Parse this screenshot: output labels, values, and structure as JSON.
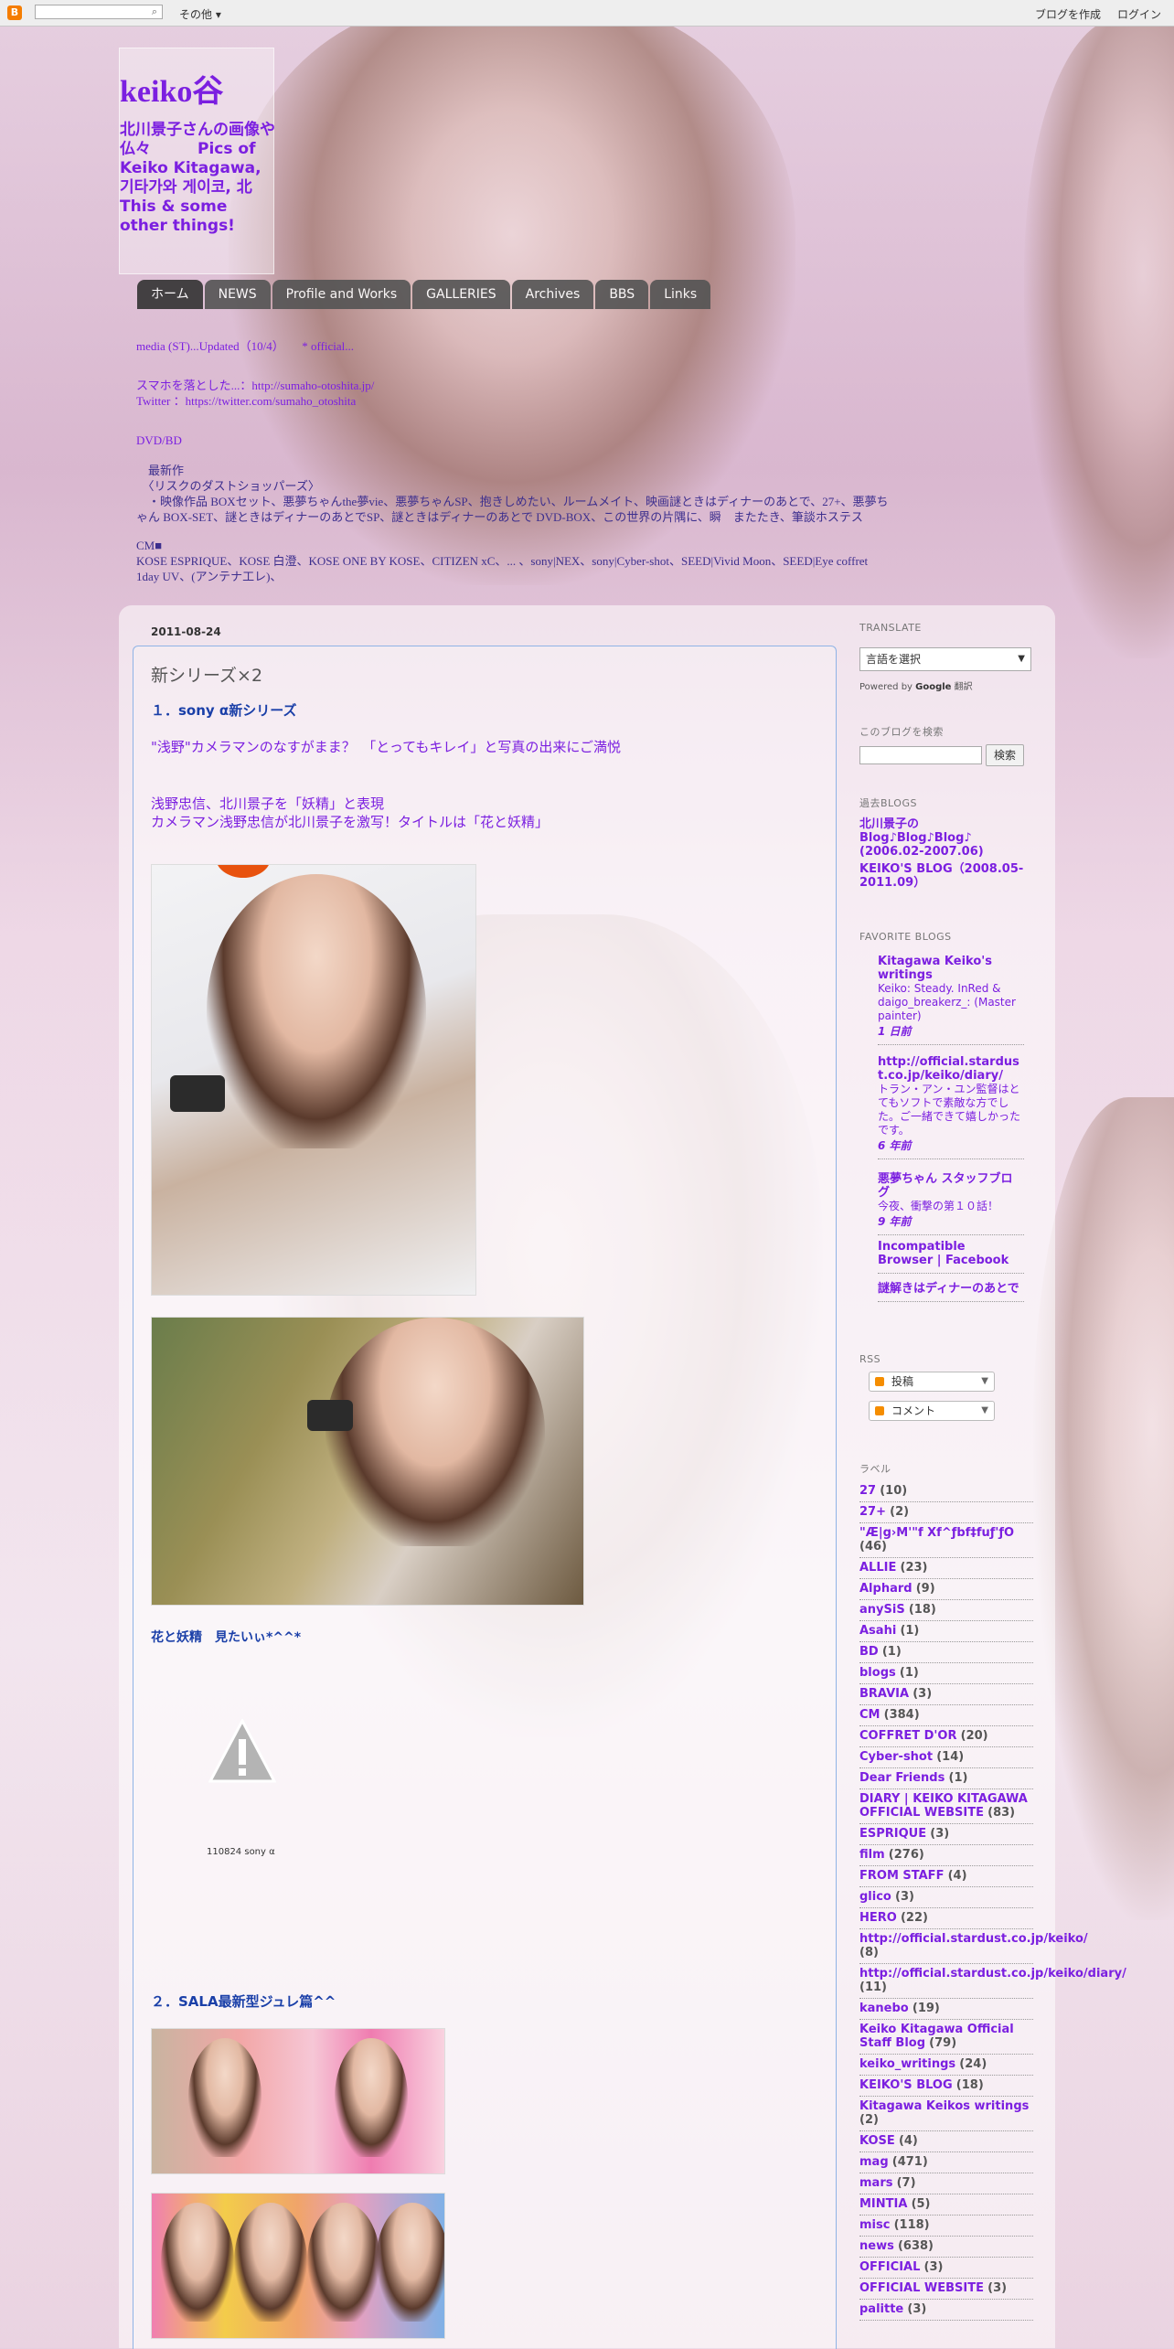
{
  "navbar": {
    "more": "その他 ▾",
    "create_blog": "ブログを作成",
    "login": "ログイン",
    "search_icon": "search-icon"
  },
  "header": {
    "title": "keiko谷",
    "description": "北川景子さんの画像や仏々　　　Pics of Keiko Kitagawa, 기타가와 게이코, 北 This & some other things!"
  },
  "tabs": [
    "ホーム",
    "NEWS",
    "Profile and Works",
    "GALLERIES",
    "Archives",
    "BBS",
    "Links"
  ],
  "news": {
    "line1": "media (ST)...Updated（10/4）　　* official...",
    "line2": "スマホを落とした...：http://sumaho-otoshita.jp/",
    "line3": "Twitter ：https://twitter.com/sumaho_otoshita",
    "line4": "DVD/BD",
    "line5": "　最新作",
    "line6": "　〈リスクのダストショッパーズ〉",
    "line7": "　・映像作品 BOXセット、悪夢ちゃんthe夢vie、悪夢ちゃんSP、抱きしめたい、ルームメイト、映画謎ときはディナーのあとで、27+、悪夢ち",
    "line8": "ゃん BOX-SET、謎ときはディナーのあとでSP、謎ときはディナーのあとで DVD-BOX、この世界の片隅に、瞬　またたき、筆談ホステス",
    "cm_head": "CM■",
    "cm_line1": "KOSE ESPRIQUE、KOSE 白澄、KOSE ONE BY KOSE、CITIZEN xC、... 、sony|NEX、sony|Cyber-shot、SEED|Vivid Moon、SEED|Eye coffret",
    "cm_line2": "1day UV、(アンテナ工レ)、"
  },
  "post": {
    "date": "2011-08-24",
    "title": "新シリーズ×2",
    "heading1": "１．sony α新シリーズ",
    "quote1": "\"浅野\"カメラマンのなすがまま？　「とってもキレイ」と写真の出来にご満悦",
    "quote2": "浅野忠信、北川景子を「妖精」と表現",
    "quote3": "カメラマン浅野忠信が北川景子を激写！タイトルは「花と妖精」",
    "comment1": "花と妖精　見たいぃ*^^*",
    "video_caption": "110824 sony α",
    "heading2": "２．SALA最新型ジュレ篇^^"
  },
  "sidebar": {
    "translate_title": "TRANSLATE",
    "translate_select": "言語を選択",
    "powered_prefix": "Powered by ",
    "powered_google": "Google",
    "powered_suffix": " 翻訳",
    "search_title": "このブログを検索",
    "search_button": "検索",
    "past_title": "過去BLOGS",
    "past1": "北川景子の Blog♪Blog♪Blog♪ (2006.02-2007.06)",
    "past2": "KEIKO'S BLOG（2008.05-2011.09）",
    "fav_title": "FAVORITE BLOGS",
    "favs": [
      {
        "title": "Kitagawa Keiko's writings",
        "snippet": "Keiko: Steady. InRed & daigo_breakerz_: (Master painter)",
        "ago": "1 日前"
      },
      {
        "title": "http://official.stardust.co.jp/keiko/diary/",
        "snippet": "トラン・アン・ユン監督はとてもソフトで素敵な方でした。ご一緒できて嬉しかったです。",
        "ago": "6 年前"
      },
      {
        "title": "悪夢ちゃん スタッフブログ",
        "snippet": "今夜、衝撃の第１０話！",
        "ago": "9 年前"
      },
      {
        "title": "Incompatible Browser | Facebook",
        "snippet": "",
        "ago": ""
      },
      {
        "title": "謎解きはディナーのあとで",
        "snippet": "",
        "ago": ""
      }
    ],
    "rss_title": "RSS",
    "rss_posts": "投稿",
    "rss_comments": "コメント",
    "labels_title": "ラベル",
    "labels": [
      {
        "name": "27",
        "count": "(10)"
      },
      {
        "name": "27+",
        "count": "(2)"
      },
      {
        "name": "\"Æ|g›M'\"f Xf^ƒbf‡fuƒ'ƒO",
        "count": "(46)"
      },
      {
        "name": "ALLIE",
        "count": "(23)"
      },
      {
        "name": "Alphard",
        "count": "(9)"
      },
      {
        "name": "anySiS",
        "count": "(18)"
      },
      {
        "name": "Asahi",
        "count": "(1)"
      },
      {
        "name": "BD",
        "count": "(1)"
      },
      {
        "name": "blogs",
        "count": "(1)"
      },
      {
        "name": "BRAVIA",
        "count": "(3)"
      },
      {
        "name": "CM",
        "count": "(384)"
      },
      {
        "name": "COFFRET D'OR",
        "count": "(20)"
      },
      {
        "name": "Cyber-shot",
        "count": "(14)"
      },
      {
        "name": "Dear Friends",
        "count": "(1)"
      },
      {
        "name": "DIARY | KEIKO KITAGAWA OFFICIAL WEBSITE",
        "count": "(83)"
      },
      {
        "name": "ESPRIQUE",
        "count": "(3)"
      },
      {
        "name": "film",
        "count": "(276)"
      },
      {
        "name": "FROM STAFF",
        "count": "(4)"
      },
      {
        "name": "glico",
        "count": "(3)"
      },
      {
        "name": "HERO",
        "count": "(22)"
      },
      {
        "name": "http://official.stardust.co.jp/keiko/",
        "count": "(8)"
      },
      {
        "name": "http://official.stardust.co.jp/keiko/diary/",
        "count": "(11)"
      },
      {
        "name": "kanebo",
        "count": "(19)"
      },
      {
        "name": "Keiko Kitagawa Official Staff Blog",
        "count": "(79)"
      },
      {
        "name": "keiko_writings",
        "count": "(24)"
      },
      {
        "name": "KEIKO'S BLOG",
        "count": "(18)"
      },
      {
        "name": "Kitagawa Keikos writings",
        "count": "(2)"
      },
      {
        "name": "KOSE",
        "count": "(4)"
      },
      {
        "name": "mag",
        "count": "(471)"
      },
      {
        "name": "mars",
        "count": "(7)"
      },
      {
        "name": "MINTIA",
        "count": "(5)"
      },
      {
        "name": "misc",
        "count": "(118)"
      },
      {
        "name": "news",
        "count": "(638)"
      },
      {
        "name": "OFFICIAL",
        "count": "(3)"
      },
      {
        "name": "OFFICIAL WEBSITE",
        "count": "(3)"
      },
      {
        "name": "palitte",
        "count": "(3)"
      }
    ]
  }
}
